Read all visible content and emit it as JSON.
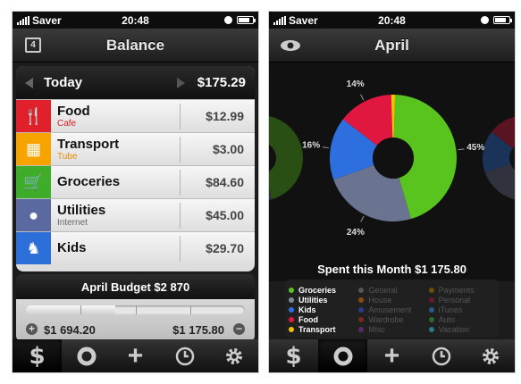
{
  "status": {
    "carrier": "Saver",
    "time": "20:48"
  },
  "left": {
    "nav": {
      "title": "Balance",
      "calendar_day": "4"
    },
    "day": {
      "label": "Today",
      "total": "$175.29"
    },
    "rows": [
      {
        "name": "Food",
        "sub": "Cafe",
        "amount": "$12.99",
        "color": "#e0202a",
        "sub_color": "#d52020",
        "icon": "fork-knife-icon",
        "glyph": "🍴"
      },
      {
        "name": "Transport",
        "sub": "Tube",
        "amount": "$3.00",
        "color": "#f7a300",
        "sub_color": "#e78d00",
        "icon": "taxi-icon",
        "glyph": "▦"
      },
      {
        "name": "Groceries",
        "sub": "",
        "amount": "$84.60",
        "color": "#3eae2a",
        "sub_color": "#2f8c20",
        "icon": "cart-icon",
        "glyph": "🛒"
      },
      {
        "name": "Utilities",
        "sub": "Internet",
        "amount": "$45.00",
        "color": "#5a6aa0",
        "sub_color": "#666",
        "icon": "lightbulb-icon",
        "glyph": "●"
      },
      {
        "name": "Kids",
        "sub": "",
        "amount": "$29.70",
        "color": "#2d6fd8",
        "sub_color": "#2d6fd8",
        "icon": "rocking-horse-icon",
        "glyph": "♞"
      }
    ],
    "budget": {
      "label": "April Budget $2 870",
      "left_amount": "$1 694.20",
      "right_amount": "$1 175.80",
      "progress": 0.41
    }
  },
  "right": {
    "nav": {
      "title": "April"
    },
    "chart_data": {
      "type": "pie",
      "title": "",
      "slices": [
        {
          "name": "Groceries",
          "value": 45,
          "label": "45%",
          "color": "#5ac41f"
        },
        {
          "name": "Utilities",
          "value": 24,
          "label": "24%",
          "color": "#6a7390"
        },
        {
          "name": "Kids",
          "value": 16,
          "label": "16%",
          "color": "#2e6fe0"
        },
        {
          "name": "Food",
          "value": 14,
          "label": "14%",
          "color": "#e01840"
        },
        {
          "name": "Transport",
          "value": 1,
          "label": "",
          "color": "#f5c000"
        }
      ]
    },
    "spent": "Spent this Month $1 175.80",
    "legend": {
      "active": [
        {
          "name": "Groceries",
          "color": "#5ac41f"
        },
        {
          "name": "Utilities",
          "color": "#7a8a9a"
        },
        {
          "name": "Kids",
          "color": "#2e6fe0"
        },
        {
          "name": "Food",
          "color": "#e01840"
        },
        {
          "name": "Transport",
          "color": "#f5c000"
        }
      ],
      "mid": [
        {
          "name": "General",
          "color": "#555555"
        },
        {
          "name": "House",
          "color": "#8a4a10"
        },
        {
          "name": "Amusement",
          "color": "#2a3a8a"
        },
        {
          "name": "Wardrobe",
          "color": "#7a2a1a"
        },
        {
          "name": "Misc",
          "color": "#5a2a6a"
        }
      ],
      "right": [
        {
          "name": "Payments",
          "color": "#6a5000"
        },
        {
          "name": "Personal",
          "color": "#6a1a2a"
        },
        {
          "name": "iTunes",
          "color": "#2a5a8a"
        },
        {
          "name": "Auto",
          "color": "#2a6a2a"
        },
        {
          "name": "Vacation",
          "color": "#2a7a8a"
        }
      ]
    }
  }
}
